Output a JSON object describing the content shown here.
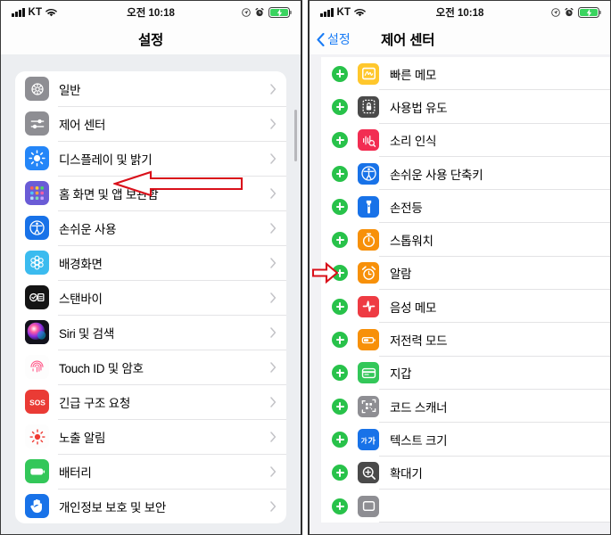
{
  "status_bar": {
    "carrier": "KT",
    "time": "오전 10:18",
    "signal_icon": "cellular-bars-icon",
    "wifi_icon": "wifi-icon",
    "location_icon": "location-arrow-icon",
    "alarm_icon": "alarm-clock-icon",
    "battery_icon": "battery-charging-icon",
    "battery_color": "#3ad45f"
  },
  "left_panel": {
    "nav": {
      "title": "설정"
    },
    "items": [
      {
        "label": "일반",
        "icon": "gear-icon",
        "color": "#8e8e93"
      },
      {
        "label": "제어 센터",
        "icon": "sliders-icon",
        "color": "#8e8e93"
      },
      {
        "label": "디스플레이 및 밝기",
        "icon": "brightness-icon",
        "color": "#2486f8"
      },
      {
        "label": "홈 화면 및 앱 보관함",
        "icon": "app-grid-icon",
        "color": "#6a5cd6"
      },
      {
        "label": "손쉬운 사용",
        "icon": "accessibility-icon",
        "color": "#1872e8"
      },
      {
        "label": "배경화면",
        "icon": "wallpaper-icon",
        "color": "#3bbbef"
      },
      {
        "label": "스탠바이",
        "icon": "standby-icon",
        "color": "#141414"
      },
      {
        "label": "Siri 및 검색",
        "icon": "siri-icon",
        "color": "#1c1c24"
      },
      {
        "label": "Touch ID 및 암호",
        "icon": "fingerprint-icon",
        "color": "#fdfdfd"
      },
      {
        "label": "긴급 구조 요청",
        "icon": "sos-icon",
        "color": "#ea3b35"
      },
      {
        "label": "노출 알림",
        "icon": "exposure-icon",
        "color": "#fdfdfd"
      },
      {
        "label": "배터리",
        "icon": "battery-icon",
        "color": "#33c759"
      },
      {
        "label": "개인정보 보호 및 보안",
        "icon": "privacy-hand-icon",
        "color": "#1872e8"
      }
    ],
    "chevron_icon": "chevron-right-icon",
    "scrollbar": "vertical-scrollbar"
  },
  "right_panel": {
    "nav": {
      "back_label": "설정",
      "back_icon": "chevron-left-icon",
      "title": "제어 센터"
    },
    "add_icon": "plus-circle-icon",
    "items": [
      {
        "label": "빠른 메모",
        "icon": "quick-note-icon",
        "color": "#ffc72c"
      },
      {
        "label": "사용법 유도",
        "icon": "guided-access-icon",
        "color": "#4a4a4a"
      },
      {
        "label": "소리 인식",
        "icon": "sound-recognition-icon",
        "color": "#f22d52"
      },
      {
        "label": "손쉬운 사용 단축키",
        "icon": "accessibility-icon",
        "color": "#1872e8"
      },
      {
        "label": "손전등",
        "icon": "flashlight-icon",
        "color": "#1872e8"
      },
      {
        "label": "스톱워치",
        "icon": "stopwatch-icon",
        "color": "#f79009"
      },
      {
        "label": "알람",
        "icon": "alarm-icon",
        "color": "#f79009"
      },
      {
        "label": "음성 메모",
        "icon": "voice-memo-icon",
        "color": "#ee3b43"
      },
      {
        "label": "저전력 모드",
        "icon": "low-power-icon",
        "color": "#f79009"
      },
      {
        "label": "지갑",
        "icon": "wallet-icon",
        "color": "#33c759"
      },
      {
        "label": "코드 스캐너",
        "icon": "code-scanner-icon",
        "color": "#8e8e93"
      },
      {
        "label": "텍스트 크기",
        "icon": "text-size-icon",
        "color": "#1872e8"
      },
      {
        "label": "확대기",
        "icon": "magnifier-icon",
        "color": "#4a4a4a"
      },
      {
        "label": "",
        "icon": "partial-row-icon",
        "color": "#8e8e93"
      }
    ]
  },
  "annotations": {
    "left_arrow": {
      "name": "red-arrow-pointing-to-control-center",
      "color": "#d9101a",
      "direction": "left"
    },
    "right_arrow": {
      "name": "red-arrow-pointing-to-flashlight-add",
      "color": "#d9101a",
      "direction": "right"
    }
  }
}
